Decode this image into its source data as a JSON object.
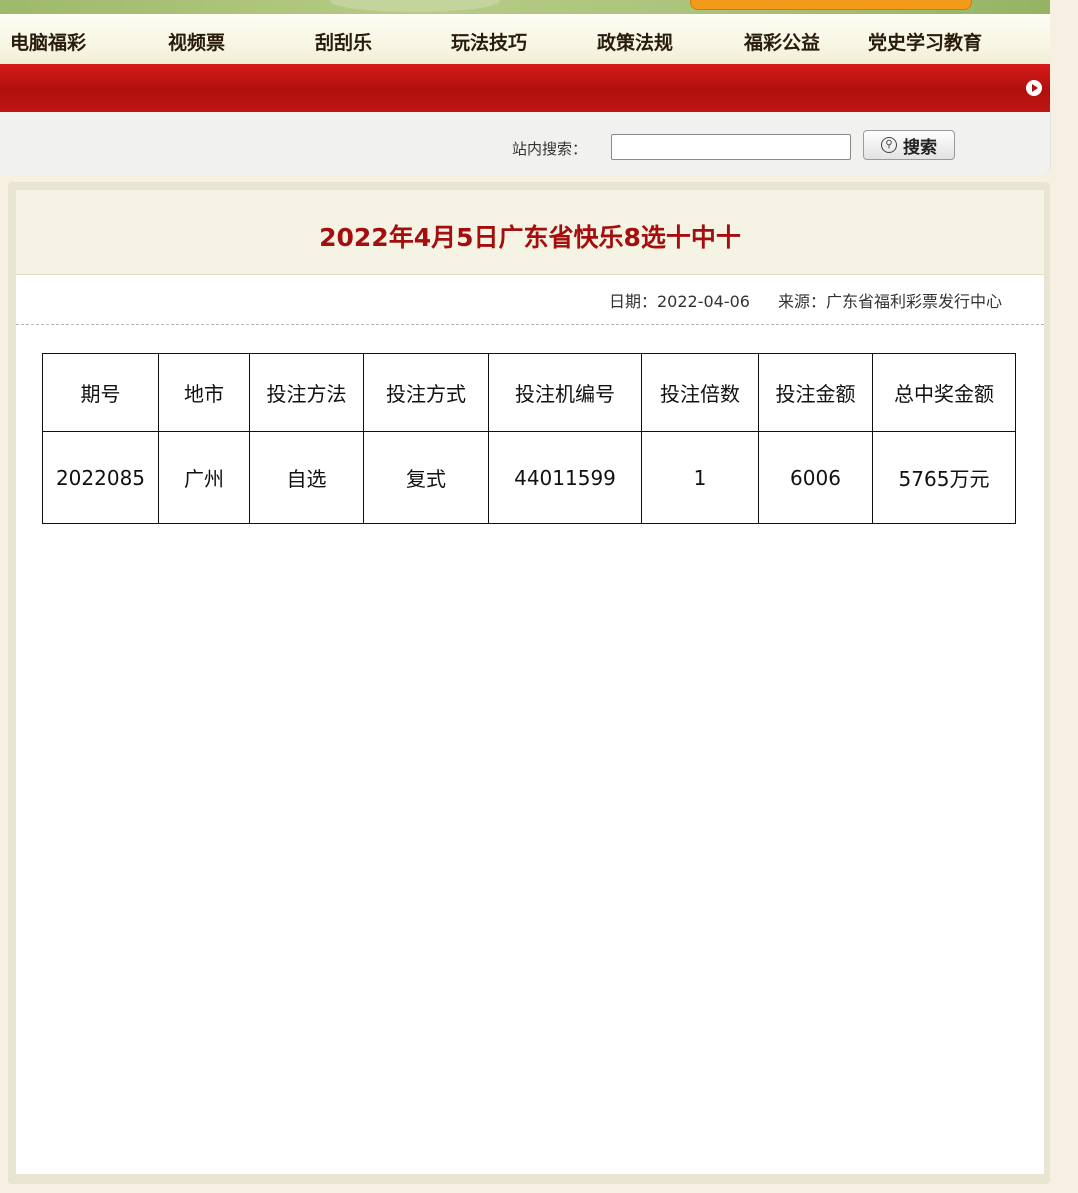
{
  "nav": {
    "items": [
      {
        "label": "电脑福彩"
      },
      {
        "label": "视频票"
      },
      {
        "label": "刮刮乐"
      },
      {
        "label": "玩法技巧"
      },
      {
        "label": "政策法规"
      },
      {
        "label": "福彩公益"
      },
      {
        "label": "党史学习教育"
      }
    ]
  },
  "search": {
    "label": "站内搜索：",
    "value": "",
    "button_label": "搜索"
  },
  "article": {
    "title": "2022年4月5日广东省快乐8选十中十",
    "date_label": "日期：",
    "date": "2022-04-06",
    "source_label": "来源：",
    "source": "广东省福利彩票发行中心"
  },
  "table": {
    "headers": [
      "期号",
      "地市",
      "投注方法",
      "投注方式",
      "投注机编号",
      "投注倍数",
      "投注金额",
      "总中奖金额"
    ],
    "rows": [
      [
        "2022085",
        "广州",
        "自选",
        "复式",
        "44011599",
        "1",
        "6006",
        "5765万元"
      ]
    ]
  },
  "colors": {
    "title_red": "#a30f0f",
    "nav_bar_red": "#c01515",
    "page_background": "#f7f0e2"
  }
}
